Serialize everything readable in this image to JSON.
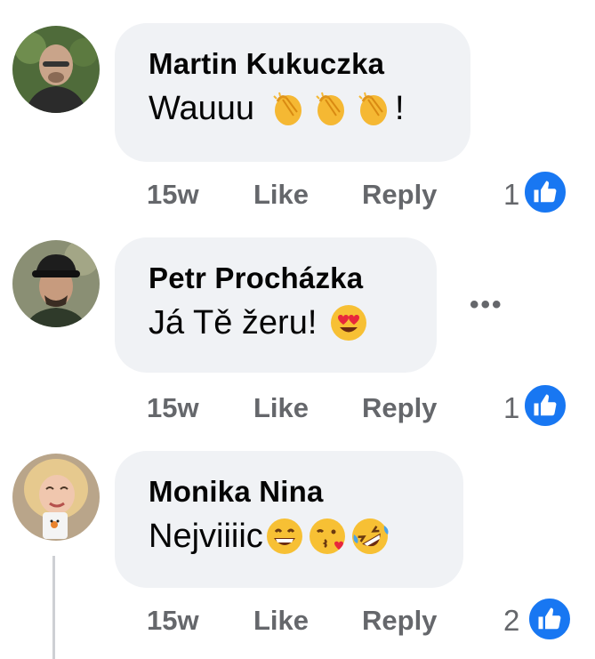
{
  "comments": [
    {
      "author": "Martin Kukuczka",
      "text": "Wauuu",
      "emojis": [
        "clapping-hands",
        "clapping-hands",
        "clapping-hands"
      ],
      "suffix": "!",
      "time": "15w",
      "like_label": "Like",
      "reply_label": "Reply",
      "reaction_count": "1",
      "reaction_icon": "thumbs-up-icon"
    },
    {
      "author": "Petr Procházka",
      "text": "Já Tě žeru!",
      "emojis": [
        "heart-eyes"
      ],
      "suffix": "",
      "time": "15w",
      "like_label": "Like",
      "reply_label": "Reply",
      "reaction_count": "1",
      "reaction_icon": "thumbs-up-icon"
    },
    {
      "author": "Monika Nina",
      "text": "Nejviiiic",
      "emojis": [
        "grinning-face",
        "face-blowing-kiss",
        "rolling-laughing"
      ],
      "suffix": "",
      "time": "15w",
      "like_label": "Like",
      "reply_label": "Reply",
      "reaction_count": "2",
      "reaction_icon": "thumbs-up-icon"
    }
  ],
  "more_options_icon": "more-dots-icon",
  "colors": {
    "bubble_bg": "#f0f2f5",
    "action_text": "#65676b",
    "like_blue": "#1877f2"
  }
}
